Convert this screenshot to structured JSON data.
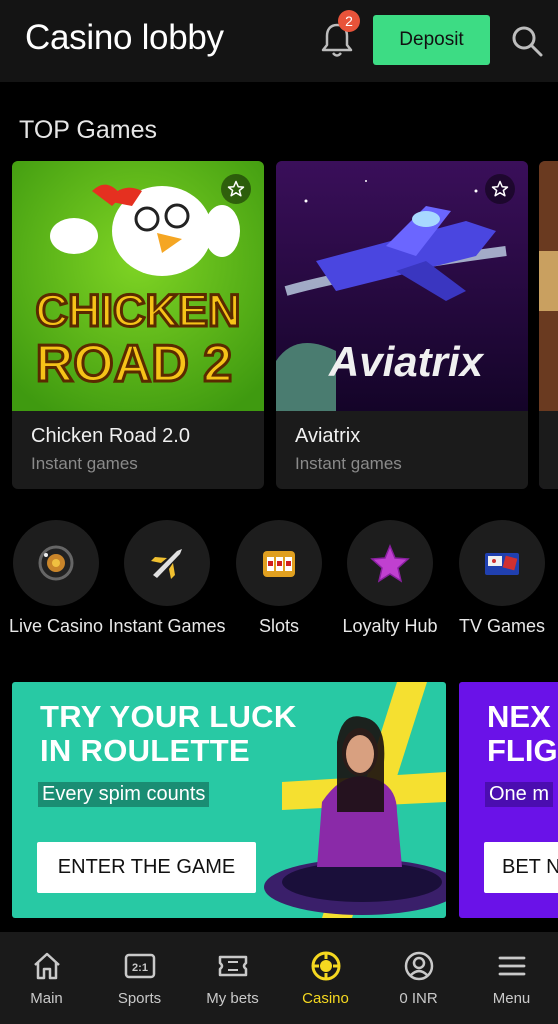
{
  "header": {
    "title": "Casino lobby",
    "notification_count": "2",
    "deposit_label": "Deposit"
  },
  "top_games": {
    "title": "TOP Games",
    "games": [
      {
        "name": "Chicken Road 2.0",
        "category": "Instant games",
        "art_text_1": "CHICKEN",
        "art_text_2": "ROAD 2"
      },
      {
        "name": "Aviatrix",
        "category": "Instant games",
        "art_text": "Aviatrix"
      }
    ]
  },
  "categories": [
    {
      "label": "Live Casino",
      "icon": "roulette-wheel-icon"
    },
    {
      "label": "Instant Games",
      "icon": "airplane-icon"
    },
    {
      "label": "Slots",
      "icon": "slot-machine-icon"
    },
    {
      "label": "Loyalty Hub",
      "icon": "star-icon"
    },
    {
      "label": "TV Games",
      "icon": "tv-games-icon"
    }
  ],
  "banners": [
    {
      "headline_1": "TRY YOUR LUCK",
      "headline_2": "IN ROULETTE",
      "subtitle": "Every spim counts",
      "button": "ENTER THE GAME"
    },
    {
      "headline_1": "NEX",
      "headline_2": "FLIG",
      "subtitle": "One m",
      "button": "BET N"
    }
  ],
  "bottom_nav": [
    {
      "label": "Main",
      "icon": "home-icon"
    },
    {
      "label": "Sports",
      "icon": "scoreboard-icon"
    },
    {
      "label": "My bets",
      "icon": "ticket-icon"
    },
    {
      "label": "Casino",
      "icon": "casino-chip-icon",
      "active": true
    },
    {
      "label": "0 INR",
      "icon": "account-icon"
    },
    {
      "label": "Menu",
      "icon": "menu-icon"
    }
  ],
  "colors": {
    "accent_green": "#3ddc84",
    "active_nav": "#f5d820",
    "badge": "#e8533a",
    "banner_teal": "#28c9a4",
    "banner_purple": "#6a12e8"
  }
}
